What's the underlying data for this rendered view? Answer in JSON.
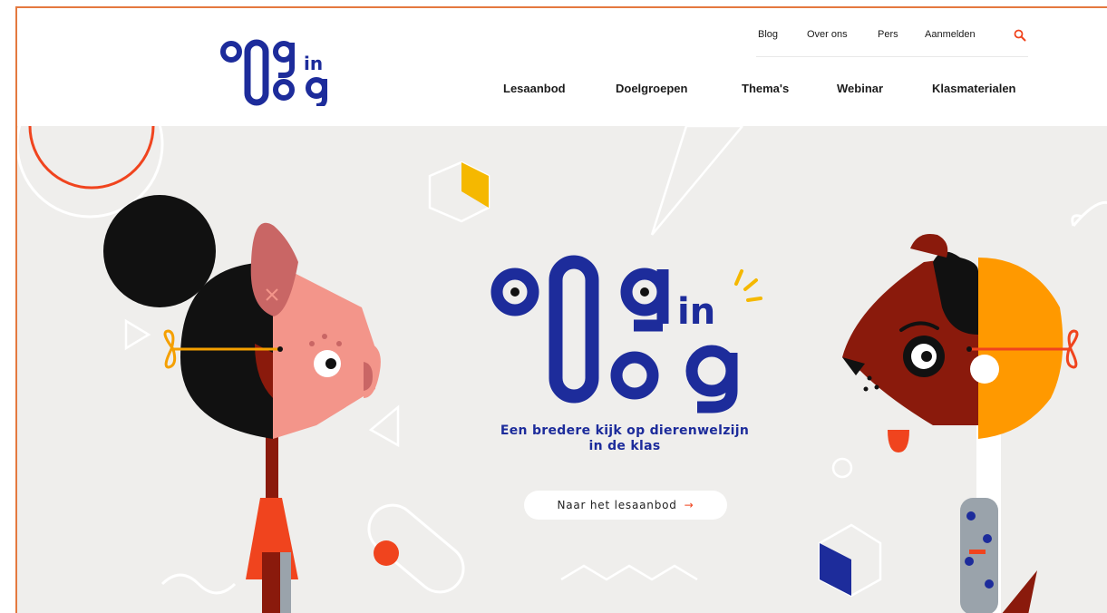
{
  "brand": {
    "logo_letters": [
      "o",
      "0",
      "g",
      "in",
      "o",
      "g"
    ],
    "accent_blue": "#1d2c9b",
    "accent_orange": "#f0441e",
    "accent_yellow": "#f5b800"
  },
  "top_nav": {
    "items": [
      {
        "label": "Blog"
      },
      {
        "label": "Over ons"
      },
      {
        "label": "Pers"
      },
      {
        "label": "Aanmelden"
      }
    ],
    "search_icon": "search-icon"
  },
  "main_nav": {
    "items": [
      {
        "label": "Lesaanbod"
      },
      {
        "label": "Doelgroepen"
      },
      {
        "label": "Thema's"
      },
      {
        "label": "Webinar"
      },
      {
        "label": "Klasmaterialen"
      }
    ]
  },
  "hero": {
    "tagline_line1": "Een bredere kijk op dierenwelzijn",
    "tagline_line2": "in de klas",
    "cta_label": "Naar het lesaanbod",
    "cta_icon": "arrow-right-icon"
  }
}
